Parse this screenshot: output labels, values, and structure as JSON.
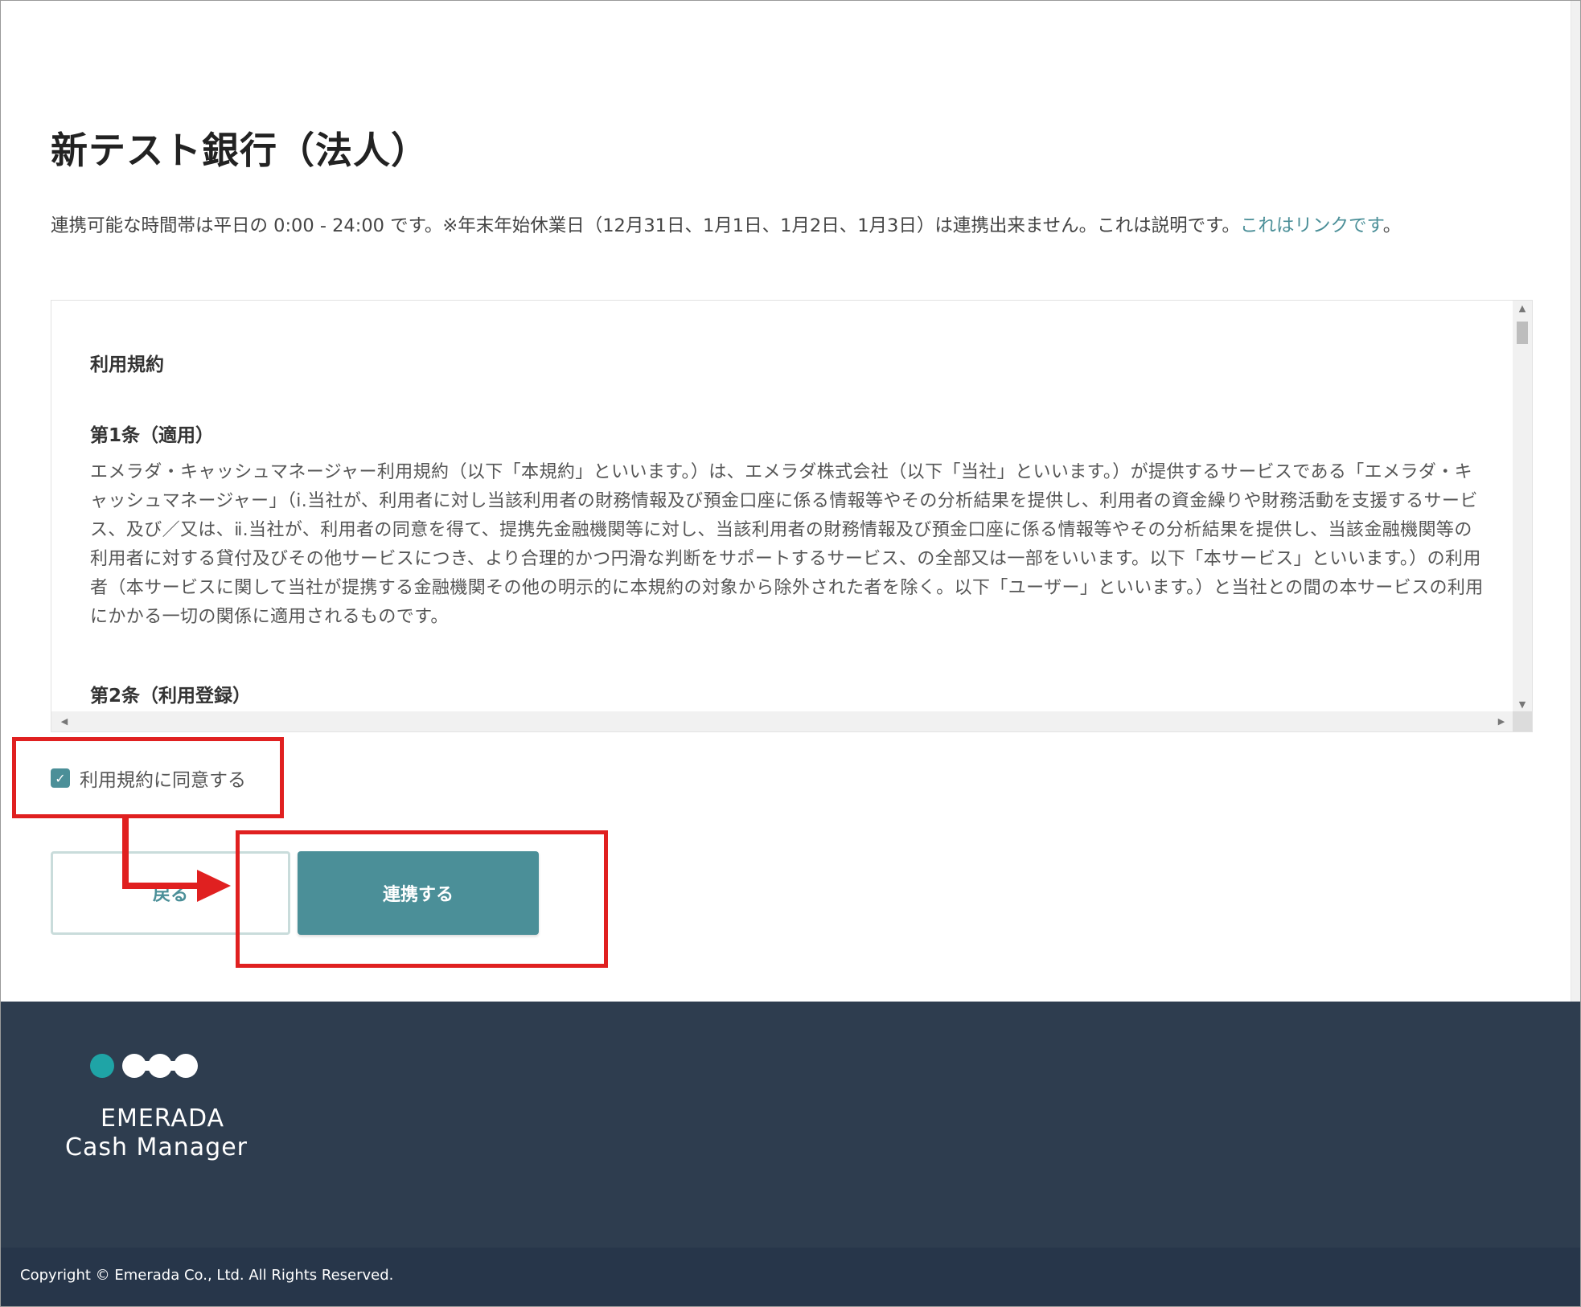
{
  "header": {
    "title": "新テスト銀行（法人）",
    "description": "連携可能な時間帯は平日の 0:00 - 24:00 です。※年末年始休業日（12月31日、1月1日、1月2日、1月3日）は連携出来ません。これは説明です。",
    "link_text": "これはリンクです",
    "description_end": "。"
  },
  "terms": {
    "heading": "利用規約",
    "article1_title": "第1条（適用）",
    "article1_body": "エメラダ・キャッシュマネージャー利用規約（以下「本規約」といいます。）は、エメラダ株式会社（以下「当社」といいます。）が提供するサービスである「エメラダ・キャッシュマネージャー」（ⅰ.当社が、利用者に対し当該利用者の財務情報及び預金口座に係る情報等やその分析結果を提供し、利用者の資金繰りや財務活動を支援するサービス、及び／又は、ⅱ.当社が、利用者の同意を得て、提携先金融機関等に対し、当該利用者の財務情報及び預金口座に係る情報等やその分析結果を提供し、当該金融機関等の利用者に対する貸付及びその他サービスにつき、より合理的かつ円滑な判断をサポートするサービス、の全部又は一部をいいます。以下「本サービス」といいます。）の利用者（本サービスに関して当社が提携する金融機関その他の明示的に本規約の対象から除外された者を除く。以下「ユーザー」といいます。）と当社との間の本サービスの利用にかかる一切の関係に適用されるものです。",
    "article2_title": "第2条（利用登録）"
  },
  "agree": {
    "label": "利用規約に同意する",
    "checked": true
  },
  "buttons": {
    "back": "戻る",
    "link": "連携する"
  },
  "footer": {
    "logo_line1": "EMERADA",
    "logo_line2": "Cash Manager",
    "copyright": "Copyright © Emerada Co., Ltd. All Rights Reserved."
  },
  "colors": {
    "accent": "#4b8f98",
    "footer_bg": "#2e3d4f",
    "annotation": "#e02020"
  }
}
